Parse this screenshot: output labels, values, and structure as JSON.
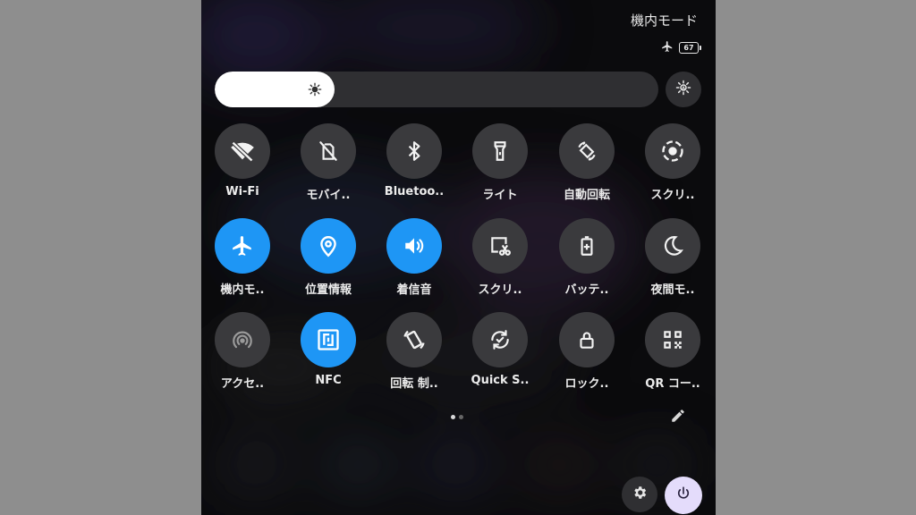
{
  "status": {
    "title": "機内モード",
    "battery_level": "67",
    "airplane_icon": "airplane-icon"
  },
  "brightness": {
    "level_percent": 27,
    "sun_icon": "sun-icon",
    "auto_icon": "auto-brightness-icon"
  },
  "tiles": [
    {
      "label": "Wi-Fi",
      "icon": "wifi-off-icon",
      "on": false
    },
    {
      "label": "モバイ..",
      "icon": "mobile-data-off-icon",
      "on": false
    },
    {
      "label": "Bluetoo..",
      "icon": "bluetooth-icon",
      "on": false
    },
    {
      "label": "ライト",
      "icon": "flashlight-icon",
      "on": false
    },
    {
      "label": "自動回転",
      "icon": "auto-rotate-icon",
      "on": false
    },
    {
      "label": "スクリ..",
      "icon": "screen-record-icon",
      "on": false
    },
    {
      "label": "機内モ..",
      "icon": "airplane-icon",
      "on": true
    },
    {
      "label": "位置情報",
      "icon": "location-icon",
      "on": true
    },
    {
      "label": "着信音",
      "icon": "volume-icon",
      "on": true
    },
    {
      "label": "スクリ..",
      "icon": "screenshot-icon",
      "on": false
    },
    {
      "label": "バッテ..",
      "icon": "battery-saver-icon",
      "on": false
    },
    {
      "label": "夜間モ..",
      "icon": "night-mode-icon",
      "on": false
    },
    {
      "label": "アクセ..",
      "icon": "hotspot-icon",
      "on": false
    },
    {
      "label": "NFC",
      "icon": "nfc-icon",
      "on": true
    },
    {
      "label": "回転 制..",
      "icon": "rotation-lock-icon",
      "on": false
    },
    {
      "label": "Quick S..",
      "icon": "quick-share-icon",
      "on": false
    },
    {
      "label": "ロック..",
      "icon": "lock-icon",
      "on": false
    },
    {
      "label": "QR コー..",
      "icon": "qr-code-icon",
      "on": false
    }
  ],
  "pager": {
    "pages": 2,
    "current": 1
  },
  "footer": {
    "edit_icon": "pencil-icon",
    "settings_icon": "gear-icon",
    "power_icon": "power-icon"
  },
  "colors": {
    "active_tile": "#1e96f5",
    "inactive_tile": "#3a3a3d",
    "power_button": "#e4dcfb"
  }
}
